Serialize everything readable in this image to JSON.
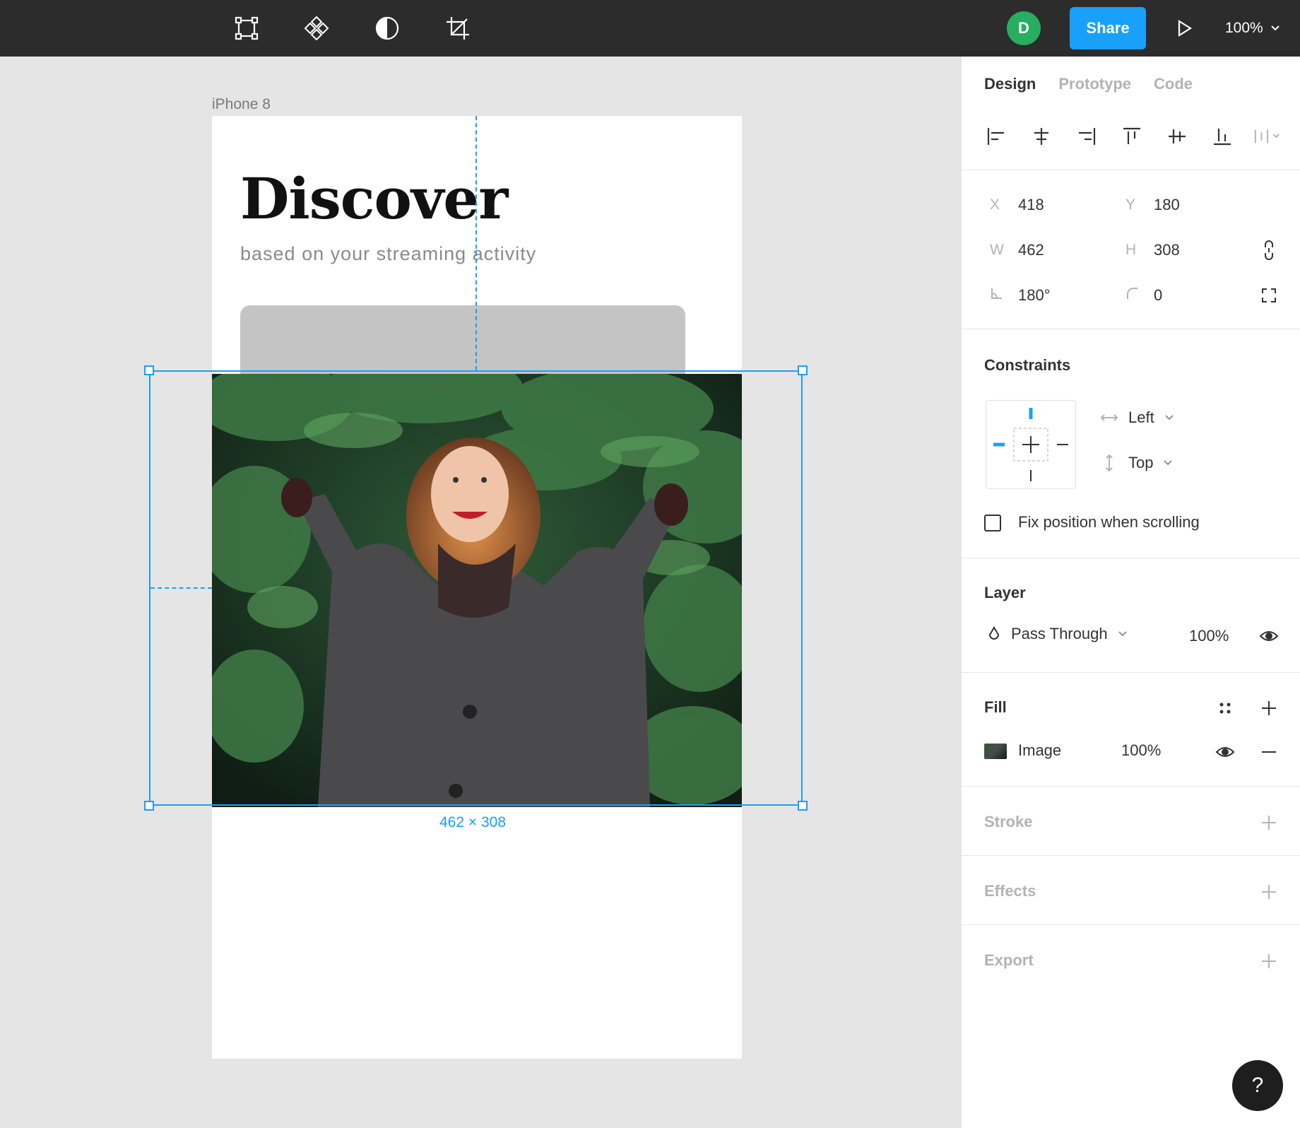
{
  "toolbar": {
    "tools": [
      "frame-icon",
      "component-icon",
      "contrast-icon",
      "crop-icon"
    ],
    "avatar_initial": "D",
    "share_label": "Share",
    "zoom_level": "100%"
  },
  "canvas": {
    "frame_label": "iPhone 8",
    "title": "Discover",
    "subtitle": "based on your streaming activity",
    "selection_dims": "462 × 308",
    "colors": {
      "selection": "#18a0fb",
      "card": "#c4c4c4"
    }
  },
  "panel": {
    "tabs": [
      "Design",
      "Prototype",
      "Code"
    ],
    "active_tab": "Design",
    "props": {
      "x_label": "X",
      "x": "418",
      "y_label": "Y",
      "y": "180",
      "w_label": "W",
      "w": "462",
      "h_label": "H",
      "h": "308",
      "rotation": "180°",
      "radius": "0"
    },
    "constraints": {
      "title": "Constraints",
      "horizontal": "Left",
      "vertical": "Top",
      "fix_position_label": "Fix position when scrolling",
      "fix_position_checked": false
    },
    "layer": {
      "title": "Layer",
      "blend": "Pass Through",
      "opacity": "100%"
    },
    "fill": {
      "title": "Fill",
      "type": "Image",
      "opacity": "100%"
    },
    "stroke_title": "Stroke",
    "effects_title": "Effects",
    "export_title": "Export"
  },
  "help_label": "?"
}
